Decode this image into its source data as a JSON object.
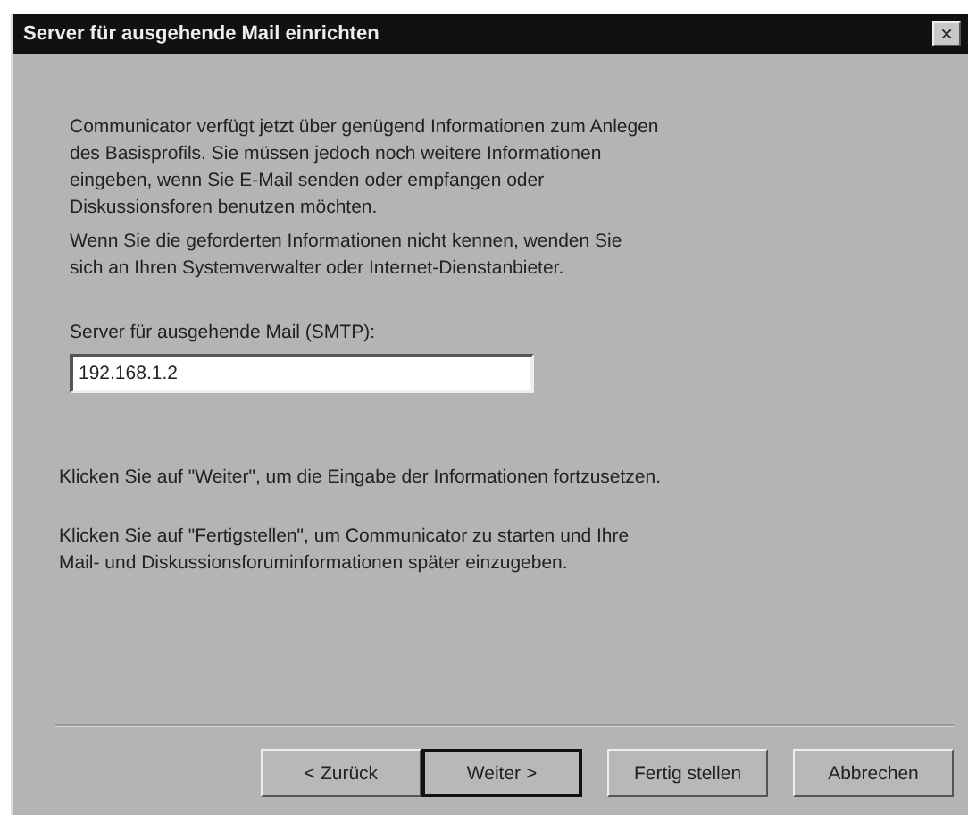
{
  "window": {
    "title": "Server für ausgehende Mail einrichten",
    "close": "×"
  },
  "intro": [
    {
      "lines": [
        "Communicator verfügt jetzt über genügend Informationen zum Anlegen",
        "des Basisprofils. Sie müssen jedoch noch weitere Informationen",
        "eingeben, wenn Sie E-Mail senden oder empfangen oder",
        "Diskussionsforen benutzen möchten."
      ]
    },
    {
      "lines": [
        "Wenn Sie die geforderten Informationen nicht kennen, wenden Sie",
        "sich an Ihren Systemverwalter oder Internet-Dienstanbieter."
      ]
    }
  ],
  "smtp_field": {
    "label": "Server für ausgehende Mail (SMTP):",
    "value": "192.168.1.2"
  },
  "hints": [
    {
      "lines": [
        "Klicken Sie auf \"Weiter\", um die Eingabe der Informationen fortzusetzen."
      ]
    },
    {
      "lines": [
        "Klicken Sie auf \"Fertigstellen\", um Communicator zu starten und Ihre",
        "Mail- und Diskussionsforuminformationen später einzugeben."
      ]
    }
  ],
  "buttons": [
    {
      "label": "< Zurück",
      "default": false
    },
    {
      "label": "Weiter >",
      "default": true
    },
    {
      "label": "Fertig stellen",
      "default": false
    },
    {
      "label": "Abbrechen",
      "default": false
    }
  ]
}
